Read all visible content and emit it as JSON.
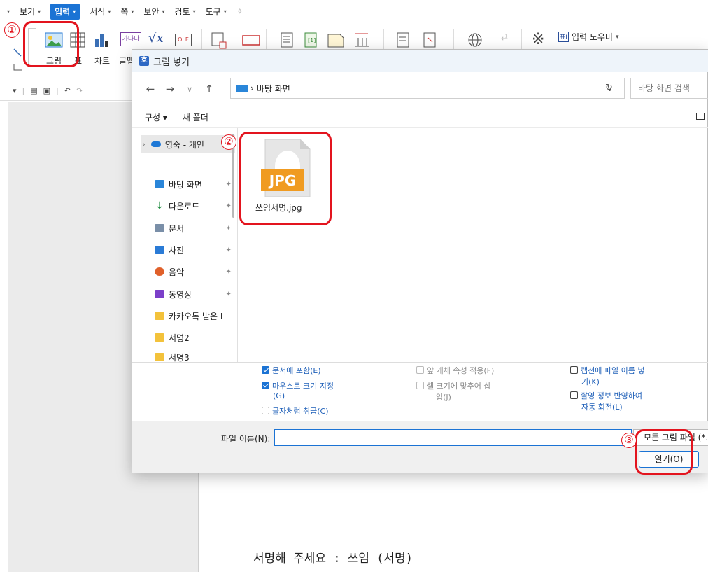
{
  "menubar": {
    "items": [
      {
        "label": "보기"
      },
      {
        "label": "입력",
        "active": true
      },
      {
        "label": "서식"
      },
      {
        "label": "쪽"
      },
      {
        "label": "보안"
      },
      {
        "label": "검토"
      },
      {
        "label": "도구"
      }
    ]
  },
  "ribbon": {
    "picture_label": "그림",
    "table_label": "표",
    "chart_label": "차트",
    "textart_label": "글맵",
    "input_helper_label": "입력 도우미",
    "textart_glyph": "가나다",
    "formula_glyph": "√x",
    "ole_glyph": "OLE"
  },
  "dialog": {
    "title": "그림 넣기",
    "logo": "호",
    "path": "바탕 화면",
    "search_placeholder": "바탕 화면 검색",
    "organize_label": "구성 ▾",
    "new_folder_label": "새 폴더",
    "nav": {
      "onedrive": "영숙 - 개인",
      "items": [
        {
          "label": "바탕 화면",
          "pinned": true,
          "color": "#2a86d9"
        },
        {
          "label": "다운로드",
          "pinned": true,
          "color": "#1b8a3c"
        },
        {
          "label": "문서",
          "pinned": true,
          "color": "#7a8fa8"
        },
        {
          "label": "사진",
          "pinned": true,
          "color": "#2a7bd6"
        },
        {
          "label": "음악",
          "pinned": true,
          "color": "#e0602a"
        },
        {
          "label": "동영상",
          "pinned": true,
          "color": "#7b3fc9"
        },
        {
          "label": "카카오톡 받은 I",
          "pinned": false,
          "color": "#f3c23b"
        },
        {
          "label": "서명2",
          "pinned": false,
          "color": "#f3c23b"
        },
        {
          "label": "서명3",
          "pinned": false,
          "color": "#f3c23b"
        }
      ]
    },
    "file": {
      "name": "쓰임서명.jpg",
      "badge": "JPG"
    },
    "options": {
      "include_in_doc": "문서에 포함(E)",
      "mouse_size": "마우스로 크기 지정",
      "mouse_size_key": "(G)",
      "treat_as_char": "글자처럼 취급(C)",
      "apply_prev": "앞 개체 속성 적용(F)",
      "fit_cell": "셀 크기에 맞추어 삽",
      "fit_cell_2": "입(J)",
      "caption_filename": "캡션에 파일 이름 넣",
      "caption_filename_2": "기(K)",
      "exif_rotate": "촬영 정보 반영하여",
      "exif_rotate_2": "자동 회전(L)"
    },
    "filename_label": "파일 이름(N):",
    "filename_value": "",
    "filetype": "모든 그림 파일 (*.",
    "open_button": "열기(O)"
  },
  "document": {
    "text": "서명해 주세요 : 쓰임 (서명)"
  },
  "annotations": {
    "step1": "①",
    "step2": "②",
    "step3": "③"
  },
  "colors": {
    "accent": "#1b73d4",
    "highlight": "#e3141e",
    "jpg_orange": "#f09b21"
  }
}
